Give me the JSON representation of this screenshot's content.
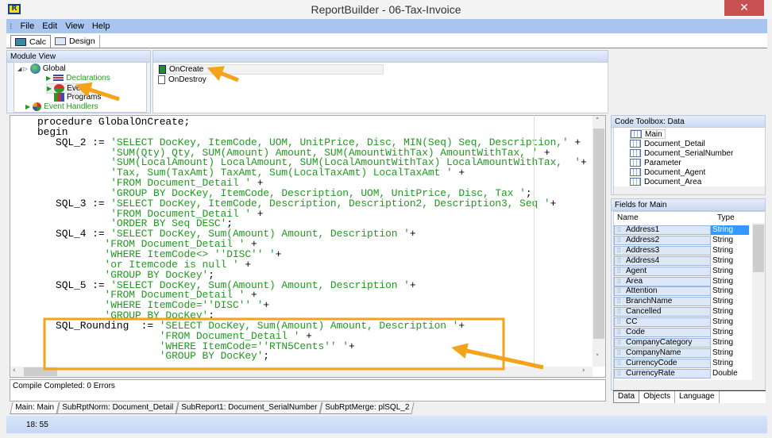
{
  "window": {
    "title": "ReportBuilder - 06-Tax-Invoice",
    "logo": "R"
  },
  "menu": [
    "File",
    "Edit",
    "View",
    "Help"
  ],
  "toolbar_tabs": [
    {
      "label": "Calc",
      "icon": "calculator-icon",
      "active": true
    },
    {
      "label": "Design",
      "icon": "design-icon",
      "active": false
    }
  ],
  "module_view": {
    "title": "Module View",
    "tree": [
      {
        "label": "Global",
        "icon": "globe-icon"
      },
      {
        "label": "Declarations",
        "icon": "declarations-icon"
      },
      {
        "label": "Events",
        "icon": "events-icon"
      },
      {
        "label": "Programs",
        "icon": "programs-icon"
      },
      {
        "label": "Event Handlers",
        "icon": "event-handlers-icon"
      }
    ]
  },
  "events_list": [
    {
      "label": "OnCreate",
      "selected": true
    },
    {
      "label": "OnDestroy",
      "selected": false
    }
  ],
  "code_lines": [
    {
      "c": "procedure GlobalOnCreate;",
      "s": "",
      "t": ""
    },
    {
      "c": "begin",
      "s": "",
      "t": ""
    },
    {
      "c": "   SQL_2 := ",
      "s": "'SELECT DocKey, ItemCode, UOM, UnitPrice, Disc, MIN(Seq) Seq, Description,'",
      "t": " +"
    },
    {
      "c": "            ",
      "s": "'SUM(Qty) Qty, SUM(Amount) Amount, SUM(AmountWithTax) AmountWithTax, '",
      "t": " +"
    },
    {
      "c": "            ",
      "s": "'SUM(LocalAmount) LocalAmount, SUM(LocalAmountWithTax) LocalAmountWithTax,  '",
      "t": "+"
    },
    {
      "c": "            ",
      "s": "'Tax, Sum(TaxAmt) TaxAmt, Sum(LocalTaxAmt) LocalTaxAmt '",
      "t": " +"
    },
    {
      "c": "            ",
      "s": "'FROM Document_Detail '",
      "t": " +"
    },
    {
      "c": "            ",
      "s": "'GROUP BY DocKey, ItemCode, Description, UOM, UnitPrice, Disc, Tax '",
      "t": ";"
    },
    {
      "c": "   SQL_3 := ",
      "s": "'SELECT DocKey, ItemCode, Description, Description2, Description3, Seq '",
      "t": "+"
    },
    {
      "c": "            ",
      "s": "'FROM Document_Detail '",
      "t": " +"
    },
    {
      "c": "            ",
      "s": "'ORDER BY Seq DESC'",
      "t": ";"
    },
    {
      "c": "   SQL_4 := ",
      "s": "'SELECT DocKey, Sum(Amount) Amount, Description '",
      "t": "+"
    },
    {
      "c": "           ",
      "s": "'FROM Document_Detail '",
      "t": " +"
    },
    {
      "c": "           ",
      "s": "'WHERE ItemCode<> ''DISC'' '",
      "t": "+"
    },
    {
      "c": "           ",
      "s": "'or Itemcode is null '",
      "t": " +"
    },
    {
      "c": "           ",
      "s": "'GROUP BY DocKey'",
      "t": ";"
    },
    {
      "c": "   SQL_5 := ",
      "s": "'SELECT DocKey, Sum(Amount) Amount, Description '",
      "t": "+"
    },
    {
      "c": "           ",
      "s": "'FROM Document_Detail '",
      "t": " +"
    },
    {
      "c": "           ",
      "s": "'WHERE ItemCode=''DISC'' '",
      "t": "+"
    },
    {
      "c": "           ",
      "s": "'GROUP BY DocKey'",
      "t": ";"
    },
    {
      "c": "   SQL_Rounding  := ",
      "s": "'SELECT DocKey, Sum(Amount) Amount, Description '",
      "t": "+"
    },
    {
      "c": "                    ",
      "s": "'FROM Document_Detail '",
      "t": " +"
    },
    {
      "c": "                    ",
      "s": "'WHERE ItemCode=''RTN5Cents'' '",
      "t": "+"
    },
    {
      "c": "                    ",
      "s": "'GROUP BY DocKey'",
      "t": ";"
    }
  ],
  "messages": "Compile Completed: 0 Errors",
  "bottom_tabs": [
    "Main: Main",
    "SubRptNorm: Document_Detail",
    "SubReport1: Document_SerialNumber",
    "SubRptMerge: plSQL_2"
  ],
  "status": "18: 55",
  "code_toolbox": {
    "title": "Code Toolbox: Data",
    "items": [
      "Main",
      "Document_Detail",
      "Document_SerialNumber",
      "Parameter",
      "Document_Agent",
      "Document_Area"
    ]
  },
  "fields": {
    "title": "Fields for Main",
    "columns": [
      "Name",
      "Type"
    ],
    "rows": [
      [
        "Address1",
        "String"
      ],
      [
        "Address2",
        "String"
      ],
      [
        "Address3",
        "String"
      ],
      [
        "Address4",
        "String"
      ],
      [
        "Agent",
        "String"
      ],
      [
        "Area",
        "String"
      ],
      [
        "Attention",
        "String"
      ],
      [
        "BranchName",
        "String"
      ],
      [
        "Cancelled",
        "String"
      ],
      [
        "CC",
        "String"
      ],
      [
        "Code",
        "String"
      ],
      [
        "CompanyCategory",
        "String"
      ],
      [
        "CompanyName",
        "String"
      ],
      [
        "CurrencyCode",
        "String"
      ],
      [
        "CurrencyRate",
        "Double"
      ]
    ]
  },
  "right_tabs": [
    "Data",
    "Objects",
    "Language"
  ],
  "colors": {
    "accent_annotation": "#f5a31a",
    "string_literal": "#1f9a1f",
    "selection": "#3399ff"
  }
}
